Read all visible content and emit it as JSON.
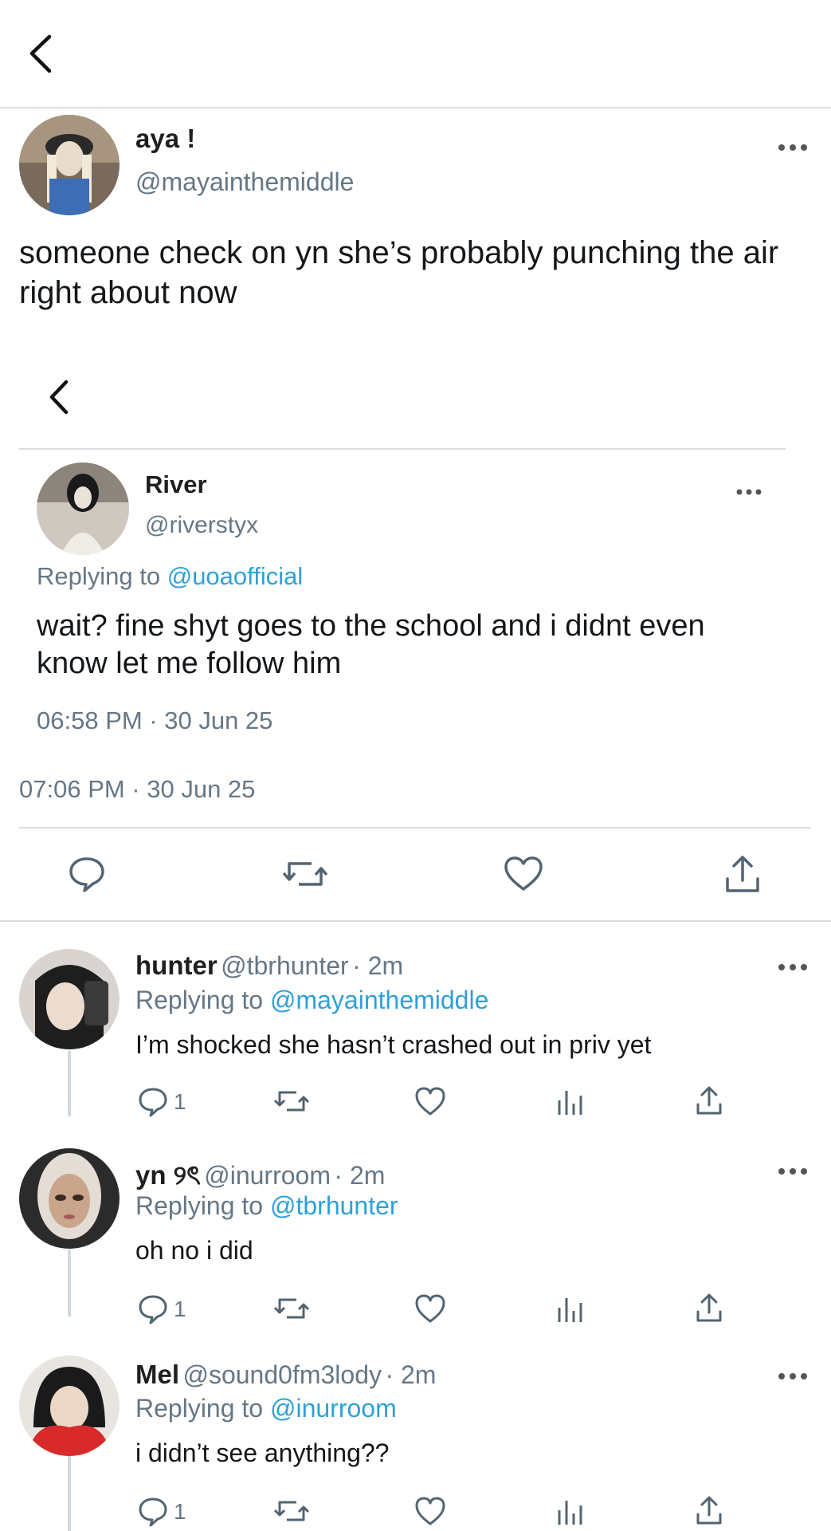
{
  "quoted_tweet": {
    "name": "aya !",
    "handle": "@mayainthemiddle",
    "text": "someone check on yn she’s probably punching the air right about now"
  },
  "embedded_tweet": {
    "name": "River",
    "handle": "@riverstyx",
    "replying_prefix": "Replying to ",
    "replying_to": "@uoaofficial",
    "text": "wait? fine shyt goes to the school and i didnt even know let me follow him",
    "timestamp": "06:58 PM · 30 Jun 25"
  },
  "main_timestamp": "07:06 PM · 30 Jun 25",
  "replies": [
    {
      "name": "hunter",
      "handle": "@tbrhunter",
      "time": "· 2m",
      "replying_prefix": "Replying to ",
      "replying_to": "@mayainthemiddle",
      "text": "I’m shocked she hasn’t crashed out in priv yet",
      "reply_count": "1"
    },
    {
      "name": "yn ୨ৎ",
      "handle": "@inurroom",
      "time": "· 2m",
      "replying_prefix": "Replying to ",
      "replying_to": "@tbrhunter",
      "text": "oh no i did",
      "reply_count": "1"
    },
    {
      "name": "Mel",
      "handle": "@sound0fm3lody",
      "time": "· 2m",
      "replying_prefix": "Replying to ",
      "replying_to": "@inurroom",
      "text": "i didn’t see anything??",
      "reply_count": "1"
    }
  ],
  "icons": {
    "back": "chevron-left-icon",
    "more": "more-horizontal-icon",
    "reply": "comment-icon",
    "retweet": "retweet-icon",
    "like": "heart-icon",
    "views": "bar-chart-icon",
    "share": "share-icon"
  },
  "colors": {
    "link": "#2fa1d6",
    "muted": "#657786",
    "text": "#14171a",
    "divider": "#dcdcdc"
  }
}
